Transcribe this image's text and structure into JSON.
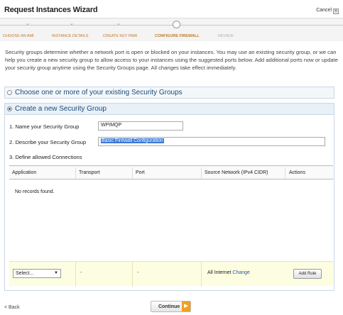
{
  "window": {
    "title": "Request Instances Wizard",
    "cancel_label": "Cancel"
  },
  "steps": [
    {
      "label": "CHOOSE AN AMI",
      "state": "done"
    },
    {
      "label": "INSTANCE DETAILS",
      "state": "done"
    },
    {
      "label": "CREATE KEY PAIR",
      "state": "done"
    },
    {
      "label": "CONFIGURE FIREWALL",
      "state": "active"
    },
    {
      "label": "REVIEW",
      "state": "future"
    }
  ],
  "intro_text": "Security groups determine whether a network port is open or blocked on your instances. You may use an existing security group, or we can help you create a new security group to allow access to your instances using the suggested ports below. Add additional ports now or update your security group anytime using the Security Groups page. All changes take effect immediately.",
  "existing_option": {
    "label": "Choose one or more of your existing Security Groups"
  },
  "new_option": {
    "label": "Create a new Security Group"
  },
  "form": {
    "name_label": "1. Name your Security Group",
    "name_value": "WPIMQP",
    "describe_label": "2. Describe your Security Group",
    "describe_value": "Basic Firewall Configuration",
    "connections_label": "3. Define allowed Connections"
  },
  "table": {
    "columns": [
      "Application",
      "Transport",
      "Port",
      "Source Network (IPv4 CIDR)",
      "Actions"
    ],
    "empty_message": "No records found."
  },
  "add_row": {
    "select_value": "Select...",
    "transport": "-",
    "port": "-",
    "source_text": "All Internet",
    "change_link": "Change",
    "add_button": "Add Rule"
  },
  "footer": {
    "back_label": "< Back",
    "continue_label": "Continue"
  },
  "colors": {
    "accent": "#c07a2a",
    "panel_header": "#e8f0f8",
    "add_row_bg": "#fdfde2",
    "continue_arrow": "#f0a020"
  }
}
